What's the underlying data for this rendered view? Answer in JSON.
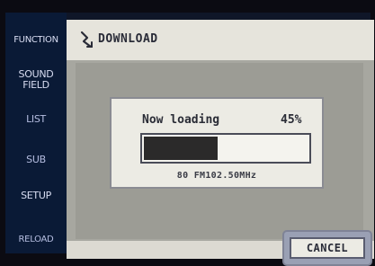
{
  "menu": {
    "items": [
      {
        "label": "FUNCTION"
      },
      {
        "label": "SOUND\nFIELD"
      },
      {
        "label": "LIST"
      },
      {
        "label": "SUB"
      },
      {
        "label": "SETUP"
      },
      {
        "label": "RELOAD"
      }
    ]
  },
  "dialog": {
    "title": "DOWNLOAD",
    "icon": "download-icon",
    "status_text": "Now loading",
    "percent_text": "45%",
    "progress_fraction": 0.45,
    "station": "80 FM102.50MHz",
    "cancel_label": "CANCEL"
  },
  "colors": {
    "menu_bg": "#0a1a36",
    "dialog_bg": "#a7a7a0",
    "progress_fill": "#2b2a2a"
  }
}
